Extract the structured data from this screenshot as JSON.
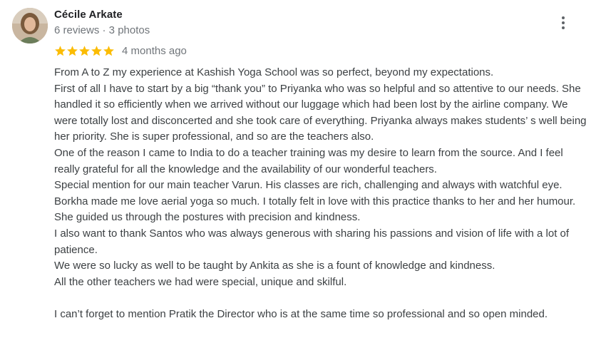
{
  "author": {
    "name": "Cécile Arkate",
    "meta": "6 reviews · 3 photos"
  },
  "review": {
    "rating": 5,
    "rating_max": 5,
    "date": "4 months ago",
    "paragraphs": [
      "From A to Z my experience at Kashish Yoga School was so perfect, beyond my expectations.",
      "First of all I have to start by a big “thank you” to Priyanka who was so helpful and so attentive to our needs. She handled it so efficiently when we arrived without our luggage which had been lost by the airline company. We were totally lost and disconcerted and she took care of everything. Priyanka always makes students’ s well being her priority. She is super professional, and so are the teachers also.",
      "One of the reason I came to India to do a teacher training was my desire to learn from the source. And I feel really grateful for all the knowledge and the availability of our wonderful teachers.",
      "Special mention for our main teacher Varun. His classes are rich, challenging and always with watchful eye.",
      "Borkha made me love aerial yoga so much. I totally felt in love with this practice thanks to her and her humour. She guided us through the postures with precision and kindness.",
      "I also want to thank Santos who was always generous with sharing his passions and vision of life with a lot of patience.",
      "We were so lucky as well to be taught by Ankita as she is a fount of knowledge and kindness.",
      "All the other teachers we had were special, unique and skilful.",
      "",
      "I can’t forget to mention Pratik the Director who is at the same time so professional and so open minded."
    ]
  },
  "colors": {
    "star": "#fbbc04",
    "name": "#202124",
    "secondary": "#70757a",
    "body": "#3c4043"
  },
  "icons": {
    "more": "more-vert-icon",
    "star": "star-icon",
    "avatar": "user-avatar"
  }
}
